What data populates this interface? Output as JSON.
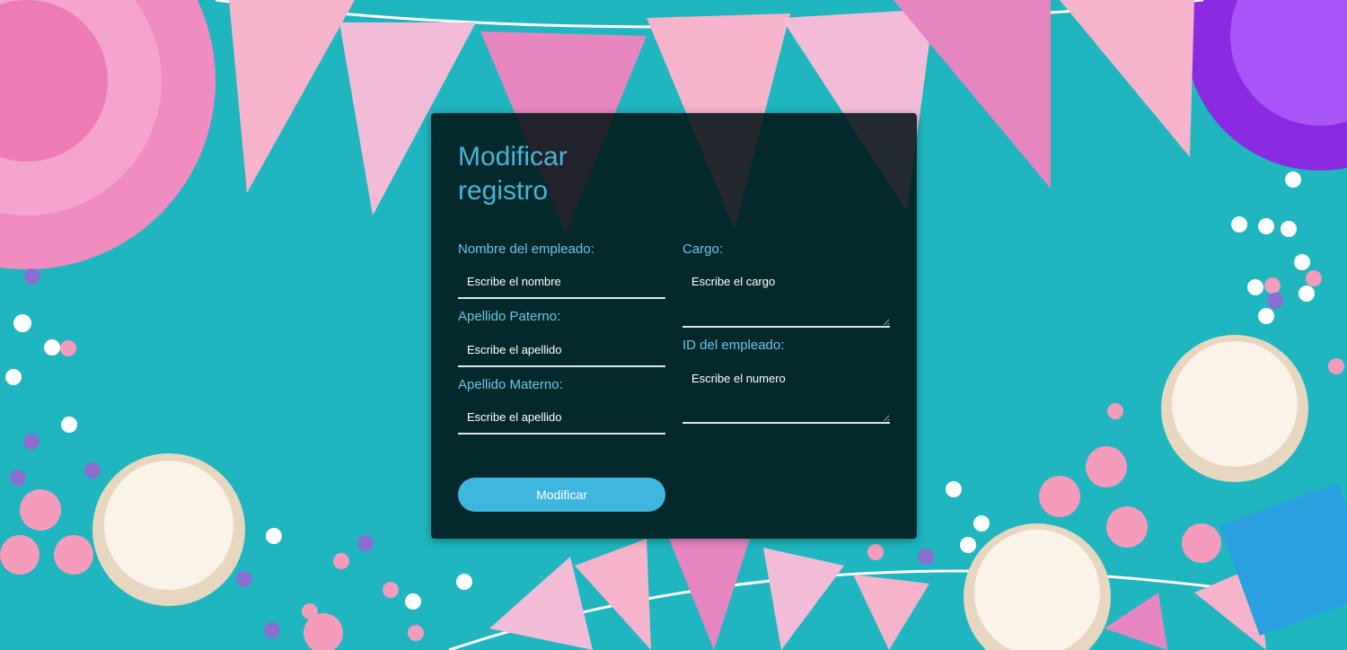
{
  "form": {
    "title": "Modificar registro",
    "fields": {
      "nombre": {
        "label": "Nombre del empleado:",
        "placeholder": "Escribe el nombre"
      },
      "apellido_paterno": {
        "label": "Apellido Paterno:",
        "placeholder": "Escribe el apellido"
      },
      "apellido_materno": {
        "label": "Apellido Materno:",
        "placeholder": "Escribe el apellido"
      },
      "cargo": {
        "label": "Cargo:",
        "placeholder": "Escribe el cargo"
      },
      "id_empleado": {
        "label": "ID del empleado:",
        "placeholder": "Escribe el numero"
      }
    },
    "submit_label": "Modificar"
  },
  "colors": {
    "background": "#1fb6c0",
    "card": "#001214",
    "accent": "#3fb6de",
    "label": "#6cc4e4"
  }
}
